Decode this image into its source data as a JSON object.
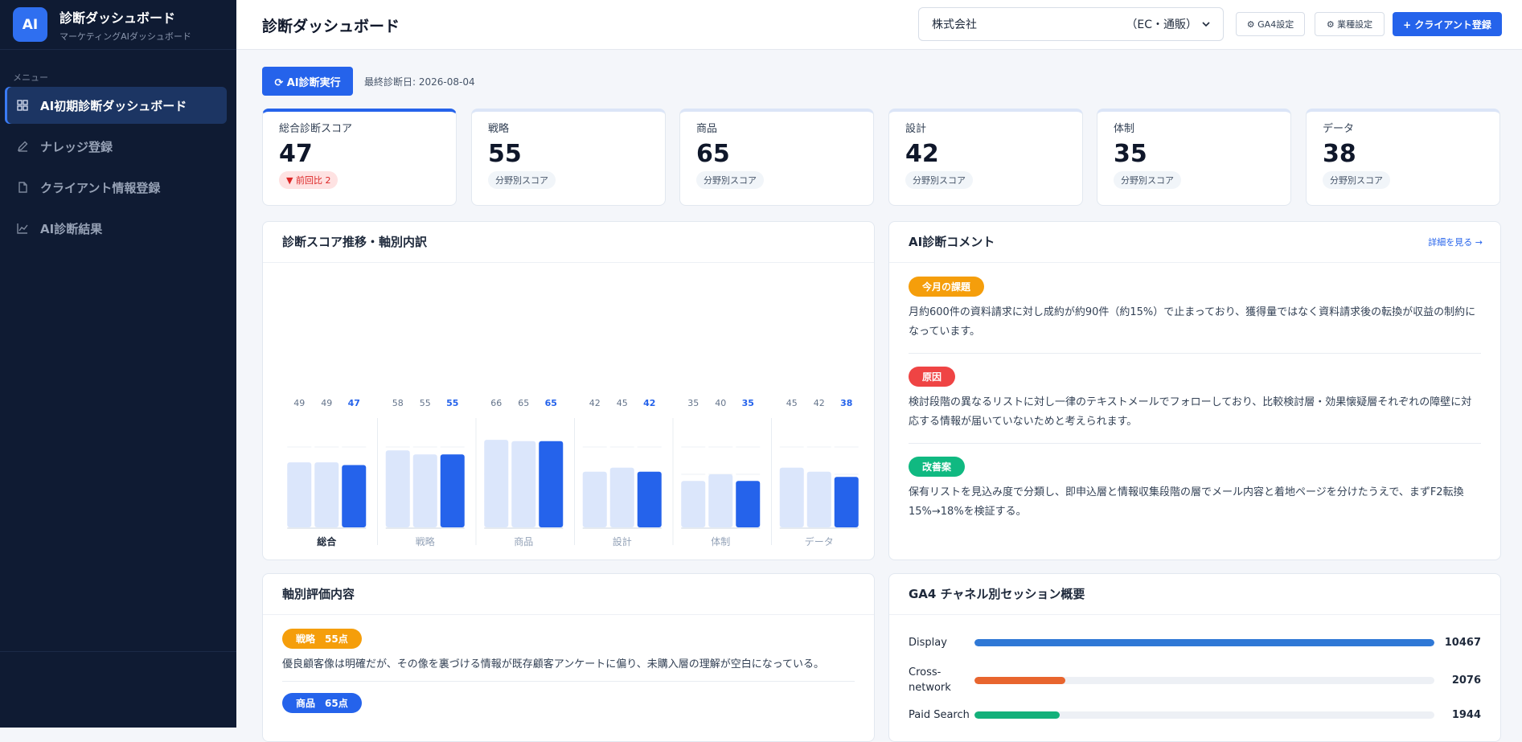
{
  "sidebar": {
    "logo": "AI",
    "title": "診断ダッシュボード",
    "subtitle": "マーケティングAIダッシュボード",
    "menu_label": "メニュー",
    "items": [
      {
        "label": "AI初期診断ダッシュボード",
        "icon": "grid-icon",
        "active": true
      },
      {
        "label": "ナレッジ登録",
        "icon": "pencil-icon",
        "active": false
      },
      {
        "label": "クライアント情報登録",
        "icon": "document-icon",
        "active": false
      },
      {
        "label": "AI診断結果",
        "icon": "chart-line-icon",
        "active": false
      }
    ]
  },
  "header": {
    "title": "診断ダッシュボード",
    "client_select": {
      "value": "株式会社",
      "sub": "（EC・通販）"
    },
    "ga4_settings": "⚙ GA4設定",
    "industry_settings": "⚙ 業種設定",
    "add_client": "+ クライアント登録"
  },
  "toolbar": {
    "run_label": "⟳ AI診断実行",
    "last_date": "最終診断日: 2026-08-04"
  },
  "score_cards": [
    {
      "label": "総合診断スコア",
      "value": "47",
      "badge": "▼ 前回比 2",
      "trend": "down"
    },
    {
      "label": "戦略",
      "value": "55",
      "badge": "分野別スコア"
    },
    {
      "label": "商品",
      "value": "65",
      "badge": "分野別スコア"
    },
    {
      "label": "設計",
      "value": "42",
      "badge": "分野別スコア"
    },
    {
      "label": "体制",
      "value": "35",
      "badge": "分野別スコア"
    },
    {
      "label": "データ",
      "value": "38",
      "badge": "分野別スコア"
    }
  ],
  "trend_panel": {
    "title": "診断スコア推移・軸別内訳"
  },
  "chart_data": {
    "type": "bar",
    "categories": [
      "総合",
      "戦略",
      "商品",
      "設計",
      "体制",
      "データ"
    ],
    "series": [
      {
        "values": [
          49,
          58,
          66,
          42,
          35,
          45
        ]
      },
      {
        "values": [
          49,
          55,
          65,
          45,
          40,
          42
        ]
      },
      {
        "values": [
          47,
          55,
          65,
          42,
          35,
          38
        ]
      }
    ],
    "ylim": [
      0,
      100
    ],
    "colors": [
      "#dbe6fb",
      "#dbe6fb",
      "#2563eb"
    ],
    "highlight_category": "総合"
  },
  "comment_panel": {
    "title": "AI診断コメント",
    "detail_link": "詳細を見る →",
    "items": [
      {
        "tag": "今月の課題",
        "color": "#f59e0b",
        "text": "月約600件の資料請求に対し成約が約90件（約15%）で止まっており、獲得量ではなく資料請求後の転換が収益の制約になっています。"
      },
      {
        "tag": "原因",
        "color": "#ef4444",
        "text": "検討段階の異なるリストに対し一律のテキストメールでフォローしており、比較検討層・効果懐疑層それぞれの障壁に対応する情報が届いていないためと考えられます。"
      },
      {
        "tag": "改善案",
        "color": "#10b981",
        "text": "保有リストを見込み度で分類し、即申込層と情報収集段階の層でメール内容と着地ページを分けたうえで、まずF2転換15%→18%を検証する。"
      }
    ]
  },
  "axis_panel": {
    "title": "軸別評価内容",
    "items": [
      {
        "tag": "戦略　55点",
        "color": "#f59e0b",
        "text": "優良顧客像は明確だが、その像を裏づける情報が既存顧客アンケートに偏り、未購入層の理解が空白になっている。"
      },
      {
        "tag": "商品　65点",
        "color": "#2563eb",
        "text": ""
      }
    ]
  },
  "ga4_panel": {
    "title": "GA4 チャネル別セッション概要",
    "channels": [
      {
        "name": "Display",
        "value": 10467,
        "value_label": "10467",
        "color": "#2f78d6"
      },
      {
        "name": "Cross-network",
        "value": 2076,
        "value_label": "2076",
        "color": "#e8652e"
      },
      {
        "name": "Paid Search",
        "value": 1944,
        "value_label": "1944",
        "color": "#13b07a"
      }
    ]
  }
}
